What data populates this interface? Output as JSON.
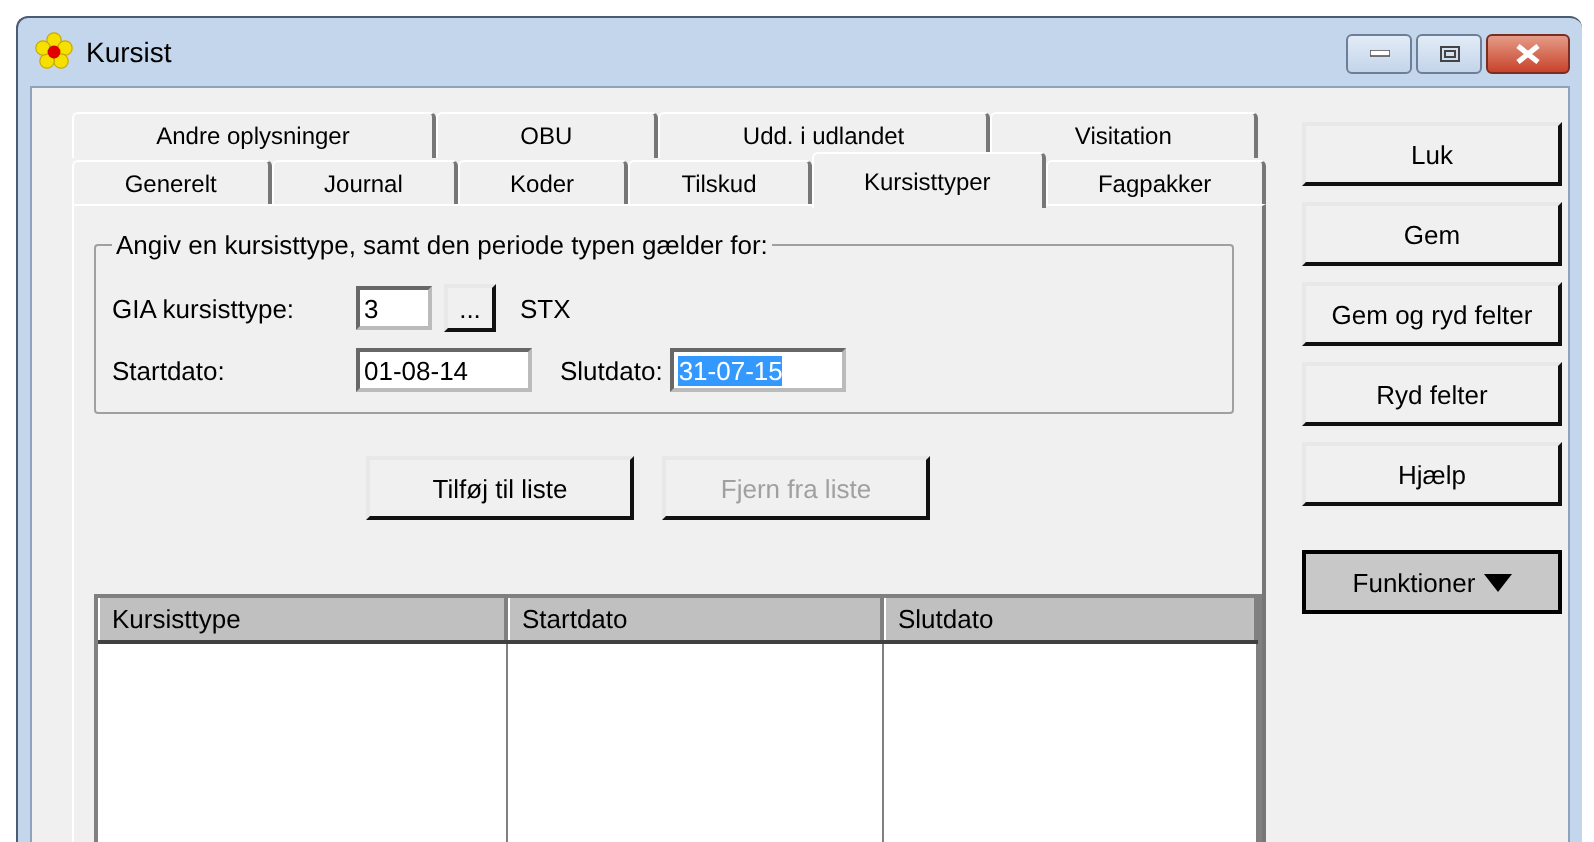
{
  "window": {
    "title": "Kursist"
  },
  "tab_rows": [
    [
      {
        "label": "Andre oplysninger",
        "selected": false
      },
      {
        "label": "OBU",
        "selected": false
      },
      {
        "label": "Udd. i udlandet",
        "selected": false
      },
      {
        "label": "Visitation",
        "selected": false
      }
    ],
    [
      {
        "label": "Generelt",
        "selected": false
      },
      {
        "label": "Journal",
        "selected": false
      },
      {
        "label": "Koder",
        "selected": false
      },
      {
        "label": "Tilskud",
        "selected": false
      },
      {
        "label": "Kursisttyper",
        "selected": true
      },
      {
        "label": "Fagpakker",
        "selected": false
      }
    ]
  ],
  "group": {
    "legend": "Angiv en kursisttype, samt den periode typen gælder for:",
    "type_label": "GIA kursisttype:",
    "type_value": "3",
    "browse_button": "...",
    "type_name": "STX",
    "start_label": "Startdato:",
    "start_value": "01-08-14",
    "start_selected": false,
    "end_label": "Slutdato:",
    "end_value": "31-07-15",
    "end_selected": true
  },
  "list_buttons": [
    {
      "label": "Tilføj til liste",
      "disabled": false
    },
    {
      "label": "Fjern fra liste",
      "disabled": true
    }
  ],
  "table": {
    "columns": [
      "Kursisttype",
      "Startdato",
      "Slutdato"
    ]
  },
  "side_buttons": [
    {
      "label": "Luk",
      "kind": "push"
    },
    {
      "label": "Gem",
      "kind": "push"
    },
    {
      "label": "Gem og ryd felter",
      "kind": "push"
    },
    {
      "label": "Ryd felter",
      "kind": "push"
    },
    {
      "label": "Hjælp",
      "kind": "push"
    },
    {
      "label": "Funktioner",
      "kind": "menu"
    }
  ]
}
